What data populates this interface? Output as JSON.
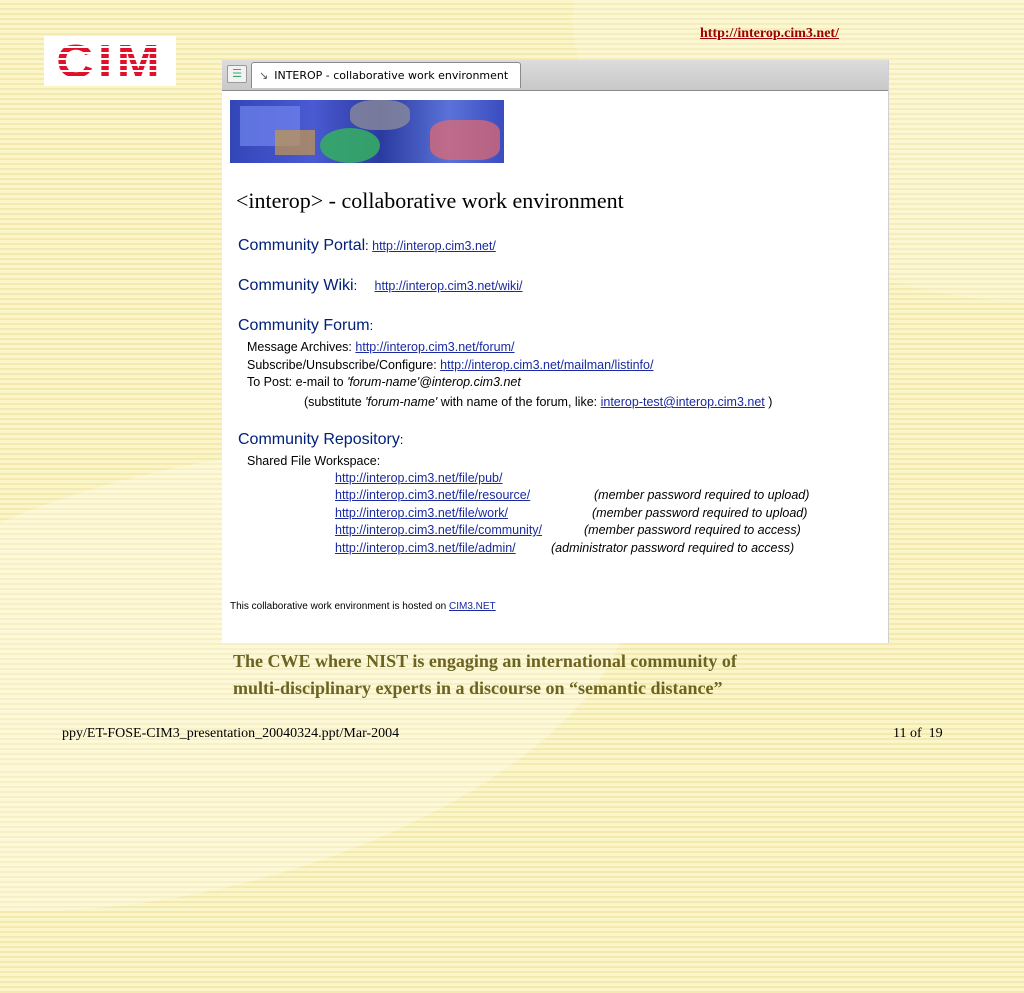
{
  "slide": {
    "top_link": "http://interop.cim3.net/",
    "logo_text": "CIM",
    "caption_line1": "The CWE where NIST is engaging an international community of",
    "caption_line2": "multi-disciplinary experts in a discourse on “semantic distance”",
    "footer_left": "ppy/ET-FOSE-CIM3_presentation_20040324.ppt/Mar-2004",
    "footer_page": "11",
    "footer_of": "of",
    "footer_total": "19"
  },
  "browser": {
    "tab_title": "INTEROP - collaborative work environment"
  },
  "page": {
    "title": "<interop> - collaborative work environment",
    "portal": {
      "label": "Community Portal",
      "colon": ":",
      "url": "http://interop.cim3.net/"
    },
    "wiki": {
      "label": "Community Wiki",
      "colon": ":",
      "url": "http://interop.cim3.net/wiki/"
    },
    "forum": {
      "label": "Community Forum",
      "colon": ":",
      "archives_label": "Message Archives:",
      "archives_url": "http://interop.cim3.net/forum/",
      "subscribe_label": "Subscribe/Unsubscribe/Configure:",
      "subscribe_url": "http://interop.cim3.net/mailman/listinfo/",
      "post_label": "To Post:  e-mail to",
      "post_address": "'forum-name'@interop.cim3.net",
      "substitute_pre": "(substitute",
      "substitute_name": "'forum-name'",
      "substitute_mid": "with name of the forum, like:",
      "substitute_example": "interop-test@interop.cim3.net",
      "substitute_post": ")"
    },
    "repository": {
      "label": "Community Repository",
      "colon": ":",
      "workspace_label": "Shared File Workspace:",
      "files": [
        {
          "url": "http://interop.cim3.net/file/pub/",
          "note": ""
        },
        {
          "url": "http://interop.cim3.net/file/resource/",
          "note": "(member password required to upload)"
        },
        {
          "url": "http://interop.cim3.net/file/work/",
          "note": "(member password required to upload)"
        },
        {
          "url": "http://interop.cim3.net/file/community/",
          "note": "(member password required to access)"
        },
        {
          "url": "http://interop.cim3.net/file/admin/",
          "note": "(administrator password required to access)"
        }
      ]
    },
    "hosted_text": "This collaborative work environment is hosted on",
    "hosted_link": "CIM3.NET"
  }
}
